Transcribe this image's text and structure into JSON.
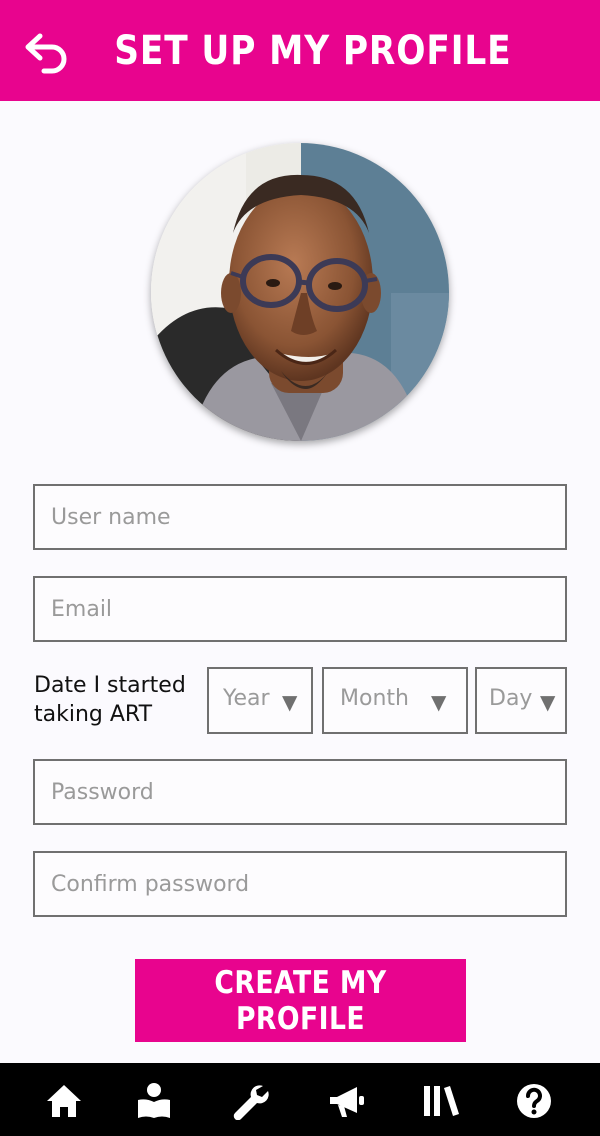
{
  "header": {
    "title": "SET UP MY PROFILE",
    "back_icon": "undo-arrow-icon"
  },
  "profile": {
    "avatar": "profile-photo"
  },
  "form": {
    "username_placeholder": "User name",
    "email_placeholder": "Email",
    "date_label_line1": "Date I started",
    "date_label_line2": "taking ART",
    "year_label": "Year",
    "month_label": "Month",
    "day_label": "Day",
    "caret": "▼",
    "password_placeholder": "Password",
    "confirm_password_placeholder": "Confirm password",
    "submit_label": "CREATE MY PROFILE"
  },
  "bottom_nav": {
    "items": [
      {
        "icon": "home-icon"
      },
      {
        "icon": "book-reader-icon"
      },
      {
        "icon": "wrench-icon"
      },
      {
        "icon": "megaphone-icon"
      },
      {
        "icon": "library-icon"
      },
      {
        "icon": "help-icon"
      }
    ]
  },
  "colors": {
    "accent": "#e8048e",
    "nav_background": "#000000",
    "background": "#fbfafe",
    "field_border": "#707070",
    "placeholder": "#9a9a9a"
  }
}
